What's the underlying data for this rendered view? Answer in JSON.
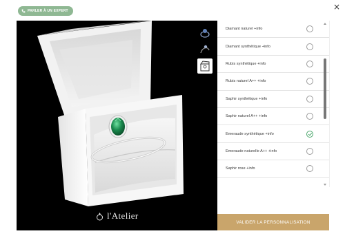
{
  "header": {
    "expert_button_label": "PARLER À UN EXPERT",
    "close_glyph": "×"
  },
  "viewer": {
    "brand_name": "l'Atelier",
    "view_buttons": [
      "ring-3d-view",
      "ring-side-view",
      "ring-box-view"
    ]
  },
  "options": [
    {
      "label": "Diamant naturel +info",
      "selected": false
    },
    {
      "label": "Diamant synthétique +info",
      "selected": false
    },
    {
      "label": "Rubis synthétique +info",
      "selected": false
    },
    {
      "label": "Rubis naturel A++ +info",
      "selected": false
    },
    {
      "label": "Saphir synthétique +info",
      "selected": false
    },
    {
      "label": "Saphir naturel A++ +info",
      "selected": false
    },
    {
      "label": "Emeraude synthétique +info",
      "selected": true
    },
    {
      "label": "Emeraude naturelle A++ +info",
      "selected": false
    },
    {
      "label": "Saphir rose +info",
      "selected": false
    }
  ],
  "footer": {
    "validate_label": "VALIDER LA PERSONNALISATION"
  },
  "colors": {
    "expert_button": "#8fb893",
    "validate_button": "#c9a56b",
    "check_green": "#4aa66a",
    "emerald": "#1a8a4e"
  }
}
